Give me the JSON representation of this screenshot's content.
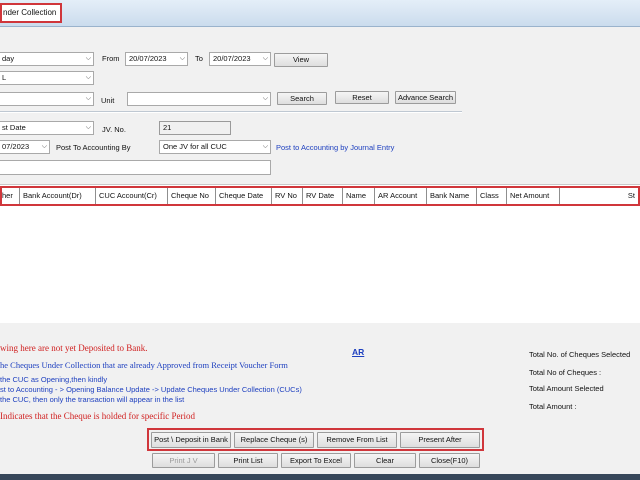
{
  "window": {
    "tab_title": "nder Collection"
  },
  "filters": {
    "period_value": "day",
    "period_placeholder_row2": "L",
    "from_label": "From",
    "from_date": "20/07/2023",
    "to_label": "To",
    "to_date": "20/07/2023",
    "view_button": "View",
    "unit_label": "Unit",
    "search_button": "Search",
    "reset_button": "Reset",
    "advance_search_button": "Advance Search"
  },
  "posting": {
    "date_type_value": "st Date",
    "jv_no_label": "JV. No.",
    "jv_no_value": "21",
    "post_date_value": "07/2023",
    "post_to_accounting_by_label": "Post To Accounting By",
    "post_to_accounting_by_value": "One JV for all CUC",
    "post_by_journal_link": "Post to Accounting by Journal Entry"
  },
  "table": {
    "columns": [
      "her",
      "Bank Account(Dr)",
      "CUC Account(Cr)",
      "Cheque No",
      "Cheque Date",
      "RV No",
      "RV Date",
      "Name",
      "AR Account",
      "Bank Name",
      "Class",
      "Net Amount",
      "St"
    ],
    "rows": []
  },
  "notes": {
    "line1": "wing here are not yet Deposited to Bank.",
    "line2": "he Cheques Under Collection that are already Approved from Receipt Voucher Form",
    "ar_link": "AR",
    "line3": "the CUC as Opening,then kindly",
    "line4": "st to Accounting - > Opening Balance Update -> Update Cheques Under Collection (CUCs)",
    "line5": "the CUC, then only the transaction will appear in the list",
    "line6": "Indicates that the Cheque is holded for specific Period"
  },
  "totals": {
    "selected_count_label": "Total No. of Cheques  Selected",
    "count_label": "Total No of Cheques :",
    "selected_amount_label": "Total Amount Selected",
    "amount_label": "Total Amount :"
  },
  "actions": {
    "post_deposit": "Post \\ Deposit in Bank",
    "replace_cheque": "Replace Cheque (s)",
    "remove_from_list": "Remove From List",
    "present_after": "Present After",
    "print_jv": "Print J V",
    "print_list": "Print List",
    "export_excel": "Export To Excel",
    "clear": "Clear",
    "close": "Close(F10)"
  },
  "colors": {
    "highlight_border": "#d0363b",
    "note_red": "#d01f1f",
    "note_blue": "#1d3fbf"
  }
}
